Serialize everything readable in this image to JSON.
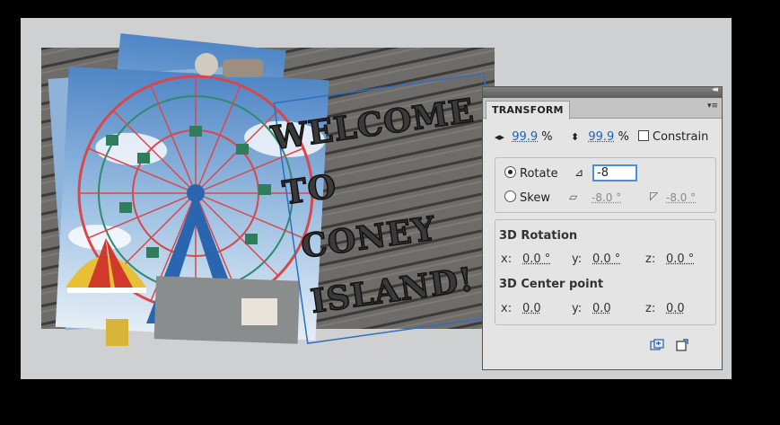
{
  "canvas": {
    "text_lines": [
      "WELCOME",
      "TO",
      "CONEY",
      "ISLAND!"
    ]
  },
  "panel": {
    "tab_title": "TRANSFORM",
    "collapse_glyph": "◂◂",
    "menu_glyph": "▾≡",
    "scale": {
      "width_value": "99.9",
      "height_value": "99.9",
      "unit": "%",
      "constrain_label": "Constrain",
      "constrain_checked": false
    },
    "rotate": {
      "label": "Rotate",
      "value": "-8",
      "selected": true
    },
    "skew": {
      "label": "Skew",
      "h_value": "-8.0 °",
      "v_value": "-8.0 °",
      "selected": false
    },
    "rotation3d": {
      "heading": "3D Rotation",
      "x_label": "x:",
      "x": "0.0 °",
      "y_label": "y:",
      "y": "0.0 °",
      "z_label": "z:",
      "z": "0.0 °"
    },
    "center3d": {
      "heading": "3D Center point",
      "x_label": "x:",
      "x": "0.0",
      "y_label": "y:",
      "y": "0.0",
      "z_label": "z:",
      "z": "0.0"
    }
  }
}
